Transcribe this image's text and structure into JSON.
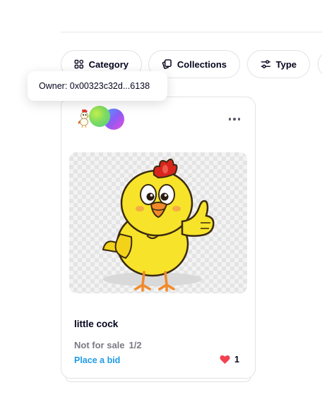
{
  "filters": {
    "category_label": "Category",
    "collections_label": "Collections",
    "type_label": "Type"
  },
  "tooltip": {
    "text": "Owner: 0x00323c32d...6138"
  },
  "card": {
    "title": "little cock",
    "sale_status": "Not for sale",
    "supply": "1/2",
    "bid_label": "Place a bid",
    "likes": "1",
    "colors": {
      "bid": "#1e9be6",
      "heart": "#f24150",
      "muted": "#7a7a85"
    },
    "icons": [
      "rooster-collection-avatar",
      "gradient-creator-avatar",
      "gradient-owner-avatar",
      "more-icon",
      "heart-icon"
    ]
  }
}
